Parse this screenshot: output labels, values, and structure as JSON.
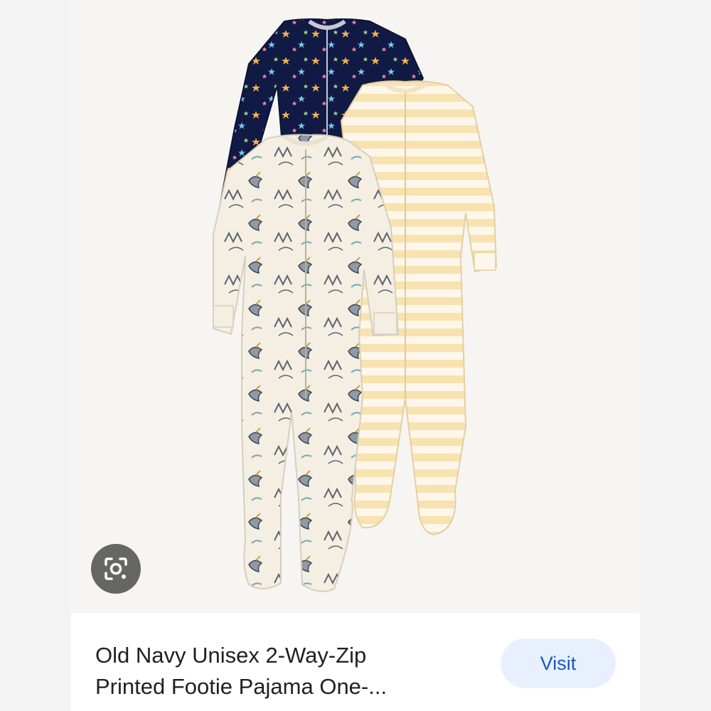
{
  "product": {
    "image_alt": "Three footie pajama one-pieces: navy with colored stars, yellow striped, and cream with unicorn print",
    "title_line1": "Old Navy Unisex 2-Way-Zip",
    "title_line2": "Printed Footie Pajama One-..."
  },
  "actions": {
    "visit_label": "Visit",
    "lens_icon": "lens-search-icon"
  },
  "colors": {
    "navy": "#101a44",
    "stripe_yellow": "#f7dfa9",
    "cream": "#f4efe2",
    "visit_bg": "#e8f0fe",
    "visit_text": "#1a56c8"
  }
}
